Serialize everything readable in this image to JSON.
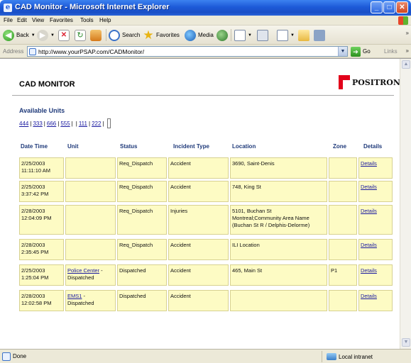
{
  "window": {
    "title": "CAD Monitor - Microsoft Internet Explorer",
    "app_icon": "ie-icon",
    "controls": [
      "minimize",
      "maximize",
      "close"
    ]
  },
  "menu": {
    "items": [
      "File",
      "Edit",
      "View",
      "Favorites",
      "Tools",
      "Help"
    ]
  },
  "toolbar": {
    "back_label": "Back",
    "search_label": "Search",
    "favorites_label": "Favorites",
    "media_label": "Media"
  },
  "address": {
    "label": "Address",
    "url": "http://www.yourPSAP.com/CADMonitor/",
    "go_label": "Go",
    "links_label": "Links"
  },
  "page": {
    "title": "CAD MONITOR",
    "logo_text": "POSITRON",
    "units_title": "Available Units",
    "units": [
      "444",
      "333",
      "666",
      "555",
      "",
      "111",
      "222"
    ]
  },
  "table": {
    "headers": [
      "Date Time",
      "Unit",
      "Status",
      "Incident Type",
      "Location",
      "Zone",
      "Details"
    ],
    "rows": [
      {
        "date": "2/25/2003",
        "time": "11:11:10 AM",
        "unit_link": "",
        "unit_status": "",
        "status": "Req_Dispatch",
        "incident": "Accident",
        "loc1": "3690, Saint-Denis",
        "loc2": "",
        "loc3": "",
        "zone": "",
        "details": "Details"
      },
      {
        "date": "2/25/2003",
        "time": "3:37:42 PM",
        "unit_link": "",
        "unit_status": "",
        "status": "Req_Dispatch",
        "incident": "Accident",
        "loc1": "748, King St",
        "loc2": "",
        "loc3": "",
        "zone": "",
        "details": "Details"
      },
      {
        "date": "2/28/2003",
        "time": "12:04:09 PM",
        "unit_link": "",
        "unit_status": "",
        "status": "Req_Dispatch",
        "incident": "Injuries",
        "loc1": "5101, Buchan St",
        "loc2": "Montreal;Community Area Name",
        "loc3": "(Buchan St R / Delphis-Delorme)",
        "zone": "",
        "details": "Details"
      },
      {
        "date": "2/28/2003",
        "time": "2:35:45 PM",
        "unit_link": "",
        "unit_status": "",
        "status": "Req_Dispatch",
        "incident": "Accident",
        "loc1": "ILI Location",
        "loc2": "",
        "loc3": "",
        "zone": "",
        "details": "Details"
      },
      {
        "date": "2/25/2003",
        "time": "1:25:04 PM",
        "unit_link": "Police Center",
        "unit_status": "Dispatched",
        "status": "Dispatched",
        "incident": "Accident",
        "loc1": "465, Main St",
        "loc2": "",
        "loc3": "",
        "zone": "P1",
        "details": "Details"
      },
      {
        "date": "2/28/2003",
        "time": "12:02:58 PM",
        "unit_link": "EMS1",
        "unit_status": "Dispatched",
        "status": "Dispatched",
        "incident": "Accident",
        "loc1": "",
        "loc2": "",
        "loc3": "",
        "zone": "",
        "details": "Details"
      }
    ]
  },
  "status": {
    "text": "Done",
    "zone": "Local intranet"
  },
  "colors": {
    "titlebar": "#1d5ad8",
    "heading": "#1f3a7a",
    "link": "#1a1aa0",
    "cell_fill": "#fdfbc4",
    "logo_red": "#e2001a"
  }
}
